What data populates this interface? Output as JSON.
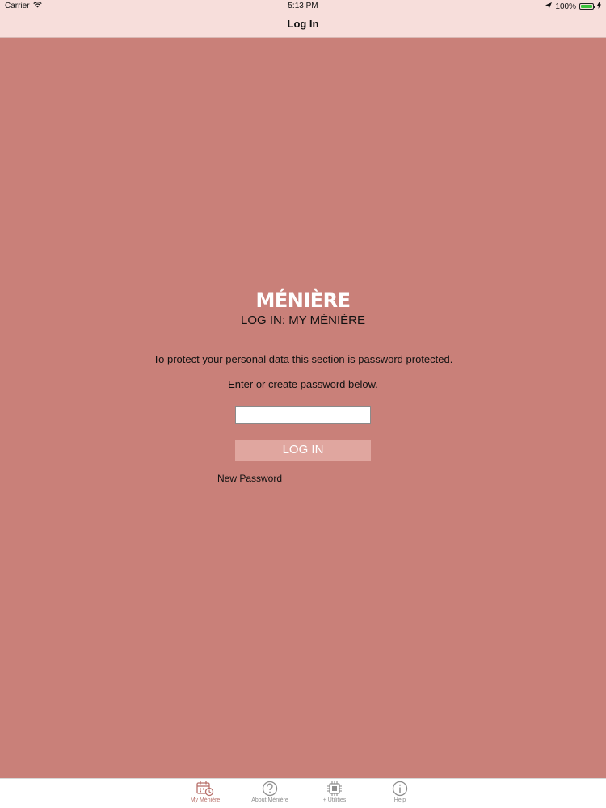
{
  "status_bar": {
    "carrier": "Carrier",
    "time": "5:13 PM",
    "battery_percent": "100%",
    "battery_level": 1.0
  },
  "nav": {
    "title": "Log In"
  },
  "main": {
    "logo_text": "MÉNIÈRE",
    "subtitle": "LOG IN: MY MÉNIÈRE",
    "message_1": "To protect your personal data this section is password protected.",
    "message_2": "Enter or create password below.",
    "password_value": "",
    "login_label": "LOG IN",
    "new_password_label": "New Password"
  },
  "tabbar": {
    "items": [
      {
        "label": "My Ménière",
        "icon": "calendar-clock-icon",
        "active": true
      },
      {
        "label": "About Ménière",
        "icon": "question-icon",
        "active": false
      },
      {
        "label": "+ Utilities",
        "icon": "chip-icon",
        "active": false
      },
      {
        "label": "Help",
        "icon": "info-icon",
        "active": false
      }
    ]
  },
  "colors": {
    "background": "#c98079",
    "header": "#f7dedb",
    "button": "#e0a69f",
    "active_tab": "#b8716b",
    "inactive_tab": "#8e8e8e"
  }
}
